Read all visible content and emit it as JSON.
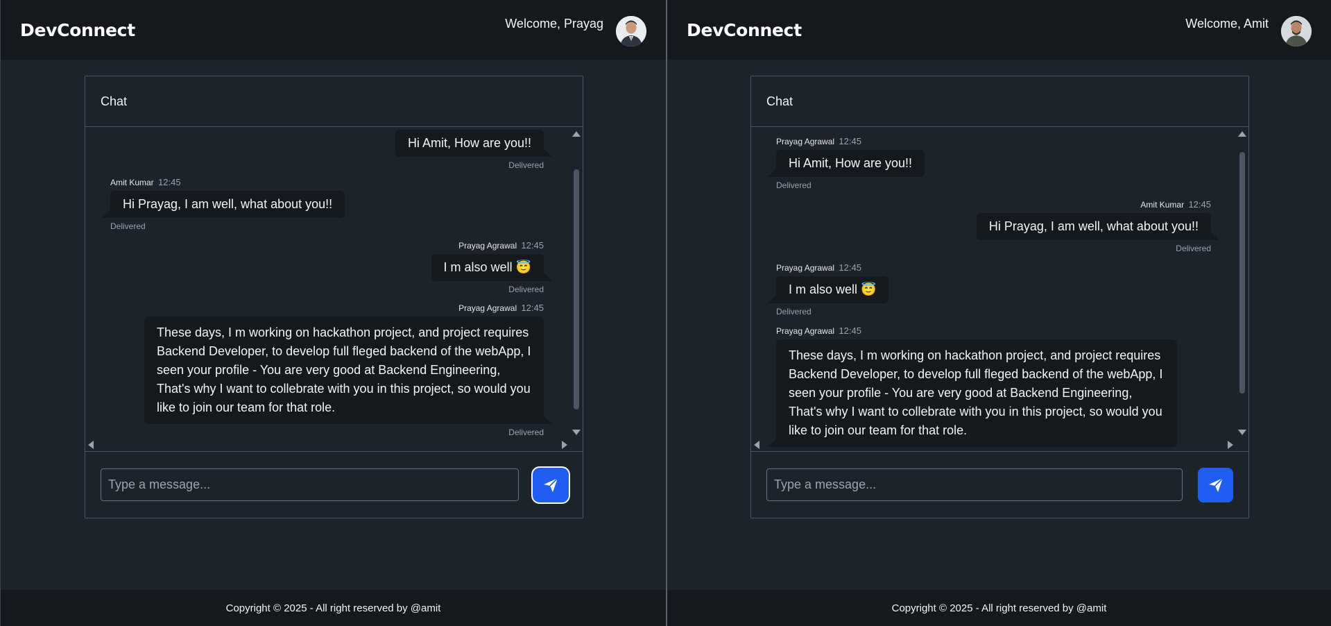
{
  "app": {
    "brand": "DevConnect",
    "footer": "Copyright © 2025 - All right reserved by @amit"
  },
  "chat": {
    "header": "Chat",
    "input_placeholder": "Type a message..."
  },
  "left": {
    "welcome": "Welcome, Prayag",
    "messages": [
      {
        "author": "",
        "time": "",
        "text": "Hi Amit, How are you!!",
        "status": "Delivered",
        "side": "end"
      },
      {
        "author": "Amit Kumar",
        "time": "12:45",
        "text": "Hi Prayag, I am well, what about you!!",
        "status": "Delivered",
        "side": "start"
      },
      {
        "author": "Prayag Agrawal",
        "time": "12:45",
        "text": "I m also well 😇",
        "status": "Delivered",
        "side": "end"
      },
      {
        "author": "Prayag Agrawal",
        "time": "12:45",
        "text": "These days, I m working on hackathon project, and project requires Backend Developer, to develop full fleged backend of the webApp, I seen your profile - You are very good at Backend Engineering, That's why I want to collebrate with you in this project, so would you like to join our team for that role.",
        "status": "Delivered",
        "side": "end"
      }
    ]
  },
  "right": {
    "welcome": "Welcome, Amit",
    "messages": [
      {
        "author": "Prayag Agrawal",
        "time": "12:45",
        "text": "Hi Amit, How are you!!",
        "status": "Delivered",
        "side": "start"
      },
      {
        "author": "Amit Kumar",
        "time": "12:45",
        "text": "Hi Prayag, I am well, what about you!!",
        "status": "Delivered",
        "side": "end"
      },
      {
        "author": "Prayag Agrawal",
        "time": "12:45",
        "text": "I m also well 😇",
        "status": "Delivered",
        "side": "start"
      },
      {
        "author": "Prayag Agrawal",
        "time": "12:45",
        "text": "These days, I m working on hackathon project, and project requires Backend Developer, to develop full fleged backend of the webApp, I seen your profile - You are very good at Backend Engineering, That's why I want to collebrate with you in this project, so would you like to join our team for that role.",
        "status": "",
        "side": "start"
      }
    ]
  },
  "icons": {
    "send": "paper-plane-icon",
    "avatar": "user-avatar"
  },
  "colors": {
    "navbar": "#15191e",
    "page": "#1d232a",
    "bubble": "#15191e",
    "primary": "#1f5ef0"
  }
}
